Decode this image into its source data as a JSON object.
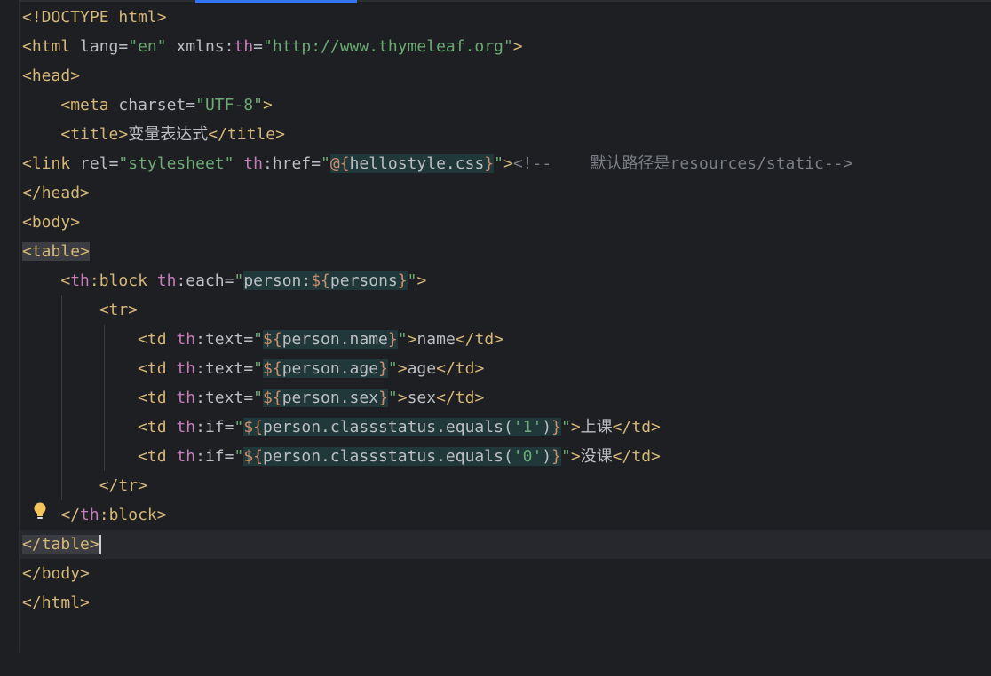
{
  "editor": {
    "tokens": {
      "lt": "<",
      "gt": ">",
      "lt_slash": "</",
      "eq": "=",
      "colon": ":",
      "quote": "\"",
      "doctype": "<!DOCTYPE html>",
      "html": "html",
      "lang": "lang",
      "en": "\"en\"",
      "xmlns": "xmlns",
      "th": "th",
      "th_url": "\"http://www.thymeleaf.org\"",
      "head": "head",
      "meta": "meta",
      "charset": "charset",
      "utf8": "\"UTF-8\"",
      "title": "title",
      "title_text": "变量表达式",
      "link": "link",
      "rel": "rel",
      "stylesheet": "\"stylesheet\"",
      "href": "href",
      "at_open": "@{",
      "css_file": "hellostyle.css",
      "close_brace": "}",
      "comment": "<!--    默认路径是resources/static-->",
      "body": "body",
      "table": "table",
      "block": "block",
      "each": "each",
      "each_expr_var": "person:",
      "dollar_open": "${",
      "persons": "persons",
      "tr": "tr",
      "td": "td",
      "text": "text",
      "if": "if",
      "person_name": "person.name",
      "person_age": "person.age",
      "person_sex": "person.sex",
      "person_cs_equals": "person.classstatus.equals(",
      "q1": "'1'",
      "q0": "'0'",
      "rparen": ")",
      "name": "name",
      "age": "age",
      "sex": "sex",
      "shangke": "上课",
      "meike": "没课"
    }
  },
  "colors": {
    "background": "#1e1f22",
    "tag": "#d5b778",
    "namespace": "#c77dbb",
    "string": "#6aab73",
    "brace": "#cf8e6d",
    "comment": "#7a7e85",
    "current_line": "#26282e",
    "accent_tab": "#3574f0"
  },
  "icons": {
    "intention": "lightbulb-icon"
  }
}
